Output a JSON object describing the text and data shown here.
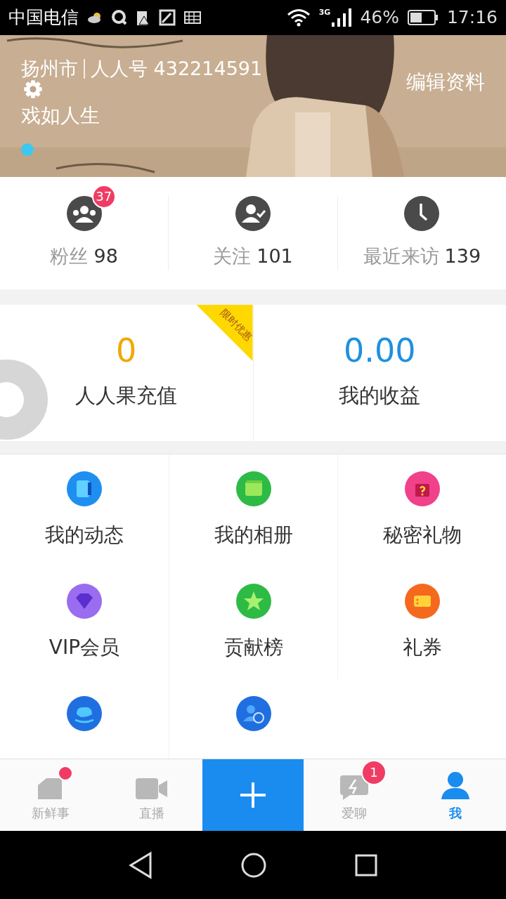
{
  "status_bar": {
    "carrier": "中国电信",
    "network": "3G",
    "battery": "46%",
    "time": "17:16"
  },
  "profile": {
    "location": "扬州市",
    "account": "人人号 432214591",
    "name": "戏如人生",
    "edit_link": "编辑资料"
  },
  "stats": [
    {
      "kind": "fans",
      "label": "粉丝",
      "value": "98",
      "badge": "37"
    },
    {
      "kind": "following",
      "label": "关注",
      "value": "101"
    },
    {
      "kind": "visitors",
      "label": "最近来访",
      "value": "139"
    }
  ],
  "wallet": [
    {
      "value": "0",
      "label": "人人果充值",
      "ribbon": "限时优惠",
      "color": "#f0a800"
    },
    {
      "value": "0.00",
      "label": "我的收益",
      "color": "#1e90e0"
    }
  ],
  "menu": [
    {
      "kind": "posts",
      "label": "我的动态",
      "color": "#1e8ff0"
    },
    {
      "kind": "album",
      "label": "我的相册",
      "color": "#2dbb45"
    },
    {
      "kind": "gift",
      "label": "秘密礼物",
      "color": "#f0418a"
    },
    {
      "kind": "vip",
      "label": "VIP会员",
      "color": "#9a6cf0"
    },
    {
      "kind": "ranking",
      "label": "贡献榜",
      "color": "#2dbb45"
    },
    {
      "kind": "coupon",
      "label": "礼券",
      "color": "#f5691e"
    },
    {
      "kind": "mount",
      "color": "#1f6fe0"
    },
    {
      "kind": "host",
      "color": "#1f6fe0"
    }
  ],
  "tabs": [
    {
      "kind": "news",
      "label": "新鲜事",
      "selected": false,
      "dot": true
    },
    {
      "kind": "live",
      "label": "直播",
      "selected": false
    },
    {
      "kind": "add",
      "selected": false
    },
    {
      "kind": "chat",
      "label": "爱聊",
      "selected": false,
      "badge": "1"
    },
    {
      "kind": "me",
      "label": "我",
      "selected": true
    }
  ]
}
